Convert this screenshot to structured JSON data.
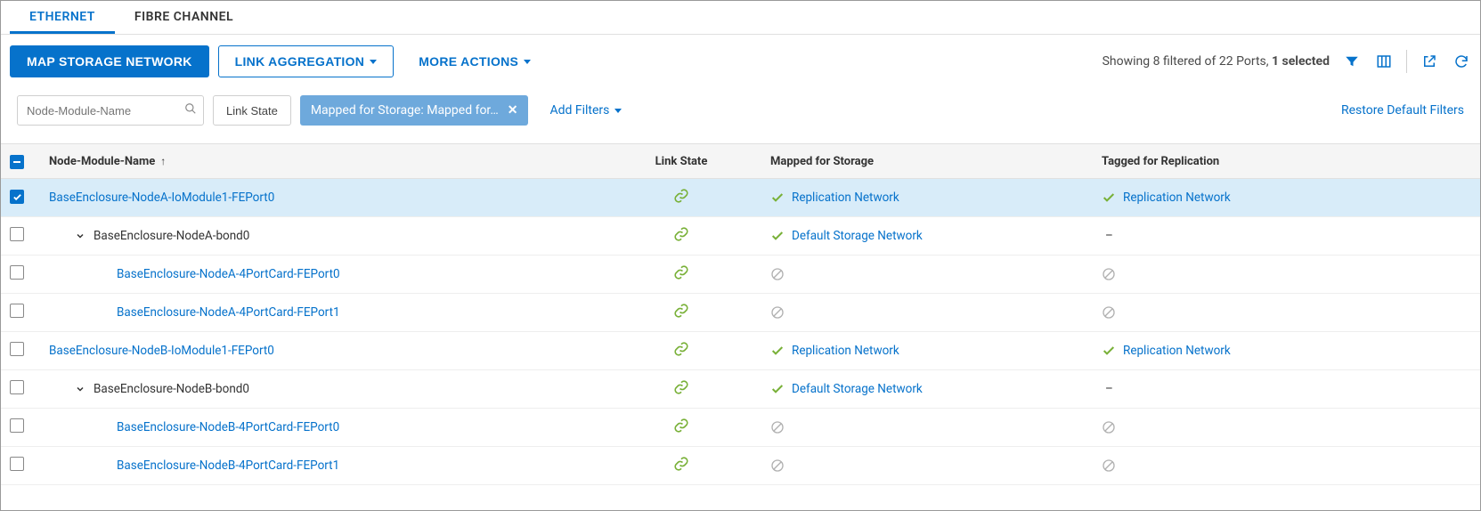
{
  "tabs": {
    "ethernet": "ETHERNET",
    "fibre": "FIBRE CHANNEL"
  },
  "toolbar": {
    "map_storage": "MAP STORAGE NETWORK",
    "link_aggregation": "LINK AGGREGATION",
    "more_actions": "MORE ACTIONS"
  },
  "status": {
    "prefix": "Showing",
    "filtered": "8",
    "midword": "filtered of",
    "total": "22",
    "portsword": "Ports,",
    "selected": "1 selected"
  },
  "filters": {
    "search_placeholder": "Node-Module-Name",
    "link_state_label": "Link State",
    "chip_label": "Mapped for Storage: Mapped for…",
    "add_filters": "Add Filters",
    "restore": "Restore Default Filters"
  },
  "columns": {
    "name": "Node-Module-Name",
    "link_state": "Link State",
    "mapped": "Mapped for Storage",
    "tagged": "Tagged for Replication"
  },
  "rows": [
    {
      "checked": true,
      "indent": 0,
      "expand": "",
      "name": "BaseEnclosure-NodeA-IoModule1-FEPort0",
      "link": true,
      "mapped_type": "link",
      "mapped_text": "Replication Network",
      "tagged_type": "link",
      "tagged_text": "Replication Network"
    },
    {
      "checked": false,
      "indent": 1,
      "expand": "v",
      "name": "BaseEnclosure-NodeA-bond0",
      "link": false,
      "mapped_type": "link",
      "mapped_text": "Default Storage Network",
      "tagged_type": "dash",
      "tagged_text": "–"
    },
    {
      "checked": false,
      "indent": 2,
      "expand": "",
      "name": "BaseEnclosure-NodeA-4PortCard-FEPort0",
      "link": true,
      "mapped_type": "none",
      "mapped_text": "",
      "tagged_type": "none",
      "tagged_text": ""
    },
    {
      "checked": false,
      "indent": 2,
      "expand": "",
      "name": "BaseEnclosure-NodeA-4PortCard-FEPort1",
      "link": true,
      "mapped_type": "none",
      "mapped_text": "",
      "tagged_type": "none",
      "tagged_text": ""
    },
    {
      "checked": false,
      "indent": 0,
      "expand": "",
      "name": "BaseEnclosure-NodeB-IoModule1-FEPort0",
      "link": true,
      "mapped_type": "link",
      "mapped_text": "Replication Network",
      "tagged_type": "link",
      "tagged_text": "Replication Network"
    },
    {
      "checked": false,
      "indent": 1,
      "expand": "v",
      "name": "BaseEnclosure-NodeB-bond0",
      "link": false,
      "mapped_type": "link",
      "mapped_text": "Default Storage Network",
      "tagged_type": "dash",
      "tagged_text": "–"
    },
    {
      "checked": false,
      "indent": 2,
      "expand": "",
      "name": "BaseEnclosure-NodeB-4PortCard-FEPort0",
      "link": true,
      "mapped_type": "none",
      "mapped_text": "",
      "tagged_type": "none",
      "tagged_text": ""
    },
    {
      "checked": false,
      "indent": 2,
      "expand": "",
      "name": "BaseEnclosure-NodeB-4PortCard-FEPort1",
      "link": true,
      "mapped_type": "none",
      "mapped_text": "",
      "tagged_type": "none",
      "tagged_text": ""
    }
  ]
}
